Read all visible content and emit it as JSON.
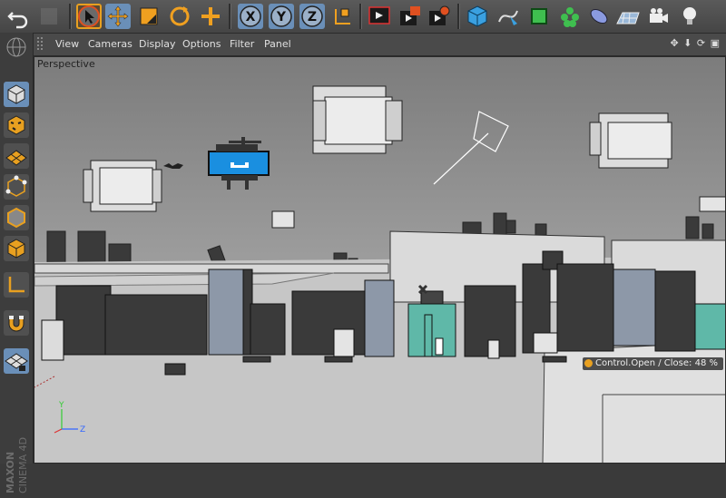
{
  "viewport": {
    "label": "Perspective",
    "hud": {
      "object": "Control.Open",
      "separator": "/",
      "attribute": "Close:",
      "value": "48 %"
    }
  },
  "menubar": {
    "items": [
      "View",
      "Cameras",
      "Display",
      "Options",
      "Filter",
      "Panel"
    ]
  },
  "toolbar": {
    "icons": [
      "undo-icon",
      "redo-icon",
      "move-arrow-icon",
      "move-icon",
      "scale-icon",
      "rotate-icon",
      "add-icon",
      "x-axis-icon",
      "y-axis-icon",
      "z-axis-icon",
      "coordinate-system-icon",
      "render-view-icon",
      "render-picture-viewer-icon",
      "render-settings-icon",
      "cube-icon",
      "spline-pen-icon",
      "subdivision-icon",
      "array-icon",
      "deformer-icon",
      "floor-icon",
      "camera-icon",
      "light-icon"
    ],
    "axis_labels": [
      "X",
      "Y",
      "Z"
    ]
  },
  "sidebar": {
    "icons": [
      "model-mode-icon",
      "texture-mode-icon",
      "workplane-icon",
      "points-mode-icon",
      "edges-mode-icon",
      "polygons-mode-icon",
      "axis-mode-icon",
      "magnet-icon",
      "locked-workplane-icon"
    ]
  },
  "branding": {
    "line1": "MAXON",
    "line2": "CINEMA 4D"
  },
  "axis_gizmo": {
    "y": "Y",
    "z": "Z"
  },
  "colors": {
    "accent": "#e8a020",
    "viewport_bg_top": "#7f7f7f",
    "viewport_bg_bottom": "#c8c8c8",
    "helicopter": "#1a8fe0",
    "building_teal": "#5fb8a8",
    "selection": "#6a8fb8"
  }
}
